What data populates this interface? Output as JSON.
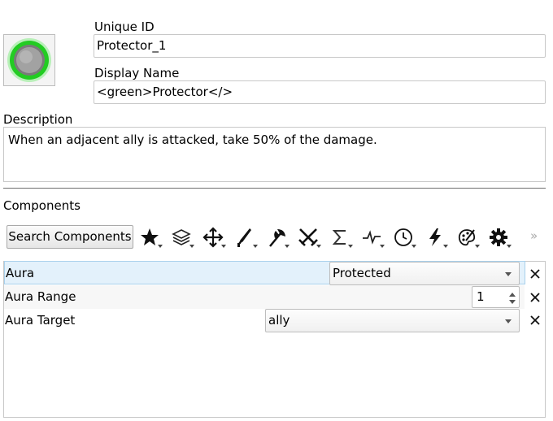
{
  "icon": {
    "name": "protector-shield-icon",
    "ring_color": "#22cc22",
    "core_color": "#9a9a9a"
  },
  "unique_id": {
    "label": "Unique ID",
    "value": "Protector_1"
  },
  "display_name": {
    "label": "Display Name",
    "value": "<green>Protector</>"
  },
  "description": {
    "label": "Description",
    "value": "When an adjacent ally is attacked, take 50% of the damage."
  },
  "components": {
    "label": "Components",
    "search_button": "Search Components",
    "toolbar_icons": [
      "star-icon",
      "layers-icon",
      "move-arrows-icon",
      "sword-icon",
      "axe-icon",
      "crossed-swords-icon",
      "sigma-icon",
      "pulse-icon",
      "clock-icon",
      "lightning-icon",
      "palette-icon",
      "gear-icon"
    ],
    "more_glyph": "»",
    "rows": [
      {
        "name": "Aura",
        "control": "combo",
        "value": "Protected"
      },
      {
        "name": "Aura Range",
        "control": "spinbox",
        "value": "1"
      },
      {
        "name": "Aura Target",
        "control": "combo",
        "value": "ally"
      }
    ]
  }
}
